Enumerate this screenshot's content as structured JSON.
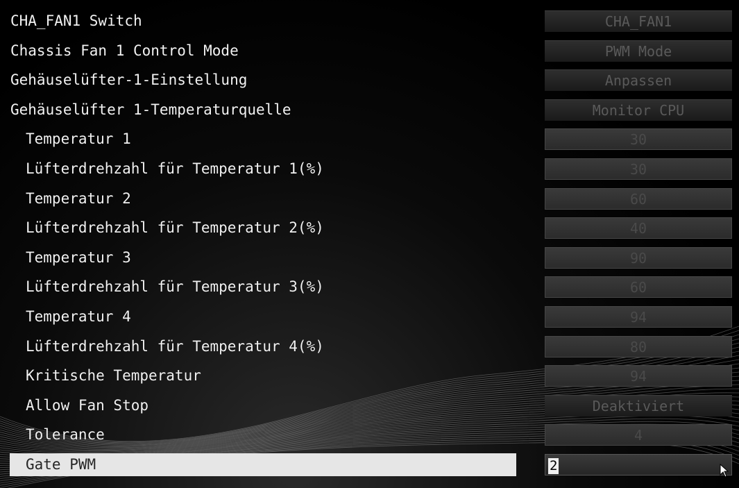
{
  "settings": [
    {
      "label": "CHA_FAN1 Switch",
      "value": "CHA_FAN1",
      "kind": "drop",
      "indent": 0
    },
    {
      "label": "Chassis Fan 1 Control Mode",
      "value": "PWM Mode",
      "kind": "drop",
      "indent": 0
    },
    {
      "label": "Gehäuselüfter-1-Einstellung",
      "value": "Anpassen",
      "kind": "drop",
      "indent": 0
    },
    {
      "label": "Gehäuselüfter 1-Temperaturquelle",
      "value": "Monitor CPU",
      "kind": "drop",
      "indent": 0
    },
    {
      "label": "Temperatur 1",
      "value": "30",
      "kind": "num",
      "indent": 1
    },
    {
      "label": "Lüfterdrehzahl für Temperatur 1(%)",
      "value": "30",
      "kind": "num",
      "indent": 1
    },
    {
      "label": "Temperatur 2",
      "value": "60",
      "kind": "num",
      "indent": 1
    },
    {
      "label": "Lüfterdrehzahl für Temperatur 2(%)",
      "value": "40",
      "kind": "num",
      "indent": 1
    },
    {
      "label": "Temperatur 3",
      "value": "90",
      "kind": "num",
      "indent": 1
    },
    {
      "label": "Lüfterdrehzahl für Temperatur 3(%)",
      "value": "60",
      "kind": "num",
      "indent": 1
    },
    {
      "label": "Temperatur 4",
      "value": "94",
      "kind": "num",
      "indent": 1
    },
    {
      "label": "Lüfterdrehzahl für Temperatur 4(%)",
      "value": "80",
      "kind": "num",
      "indent": 1
    },
    {
      "label": "Kritische Temperatur",
      "value": "94",
      "kind": "num",
      "indent": 1
    },
    {
      "label": "Allow Fan Stop",
      "value": "Deaktiviert",
      "kind": "drop",
      "indent": 1
    },
    {
      "label": "Tolerance",
      "value": "4",
      "kind": "num",
      "indent": 1
    },
    {
      "label": "Gate PWM",
      "value": "2",
      "kind": "editing",
      "indent": 1,
      "selected": true
    }
  ],
  "colors": {
    "background": "#000000",
    "label_text": "#f2f2f2",
    "highlight": "#e6e6e6",
    "value_text_dim": "#5a5a5a"
  },
  "icons": {
    "cursor": "mouse-pointer-icon"
  }
}
